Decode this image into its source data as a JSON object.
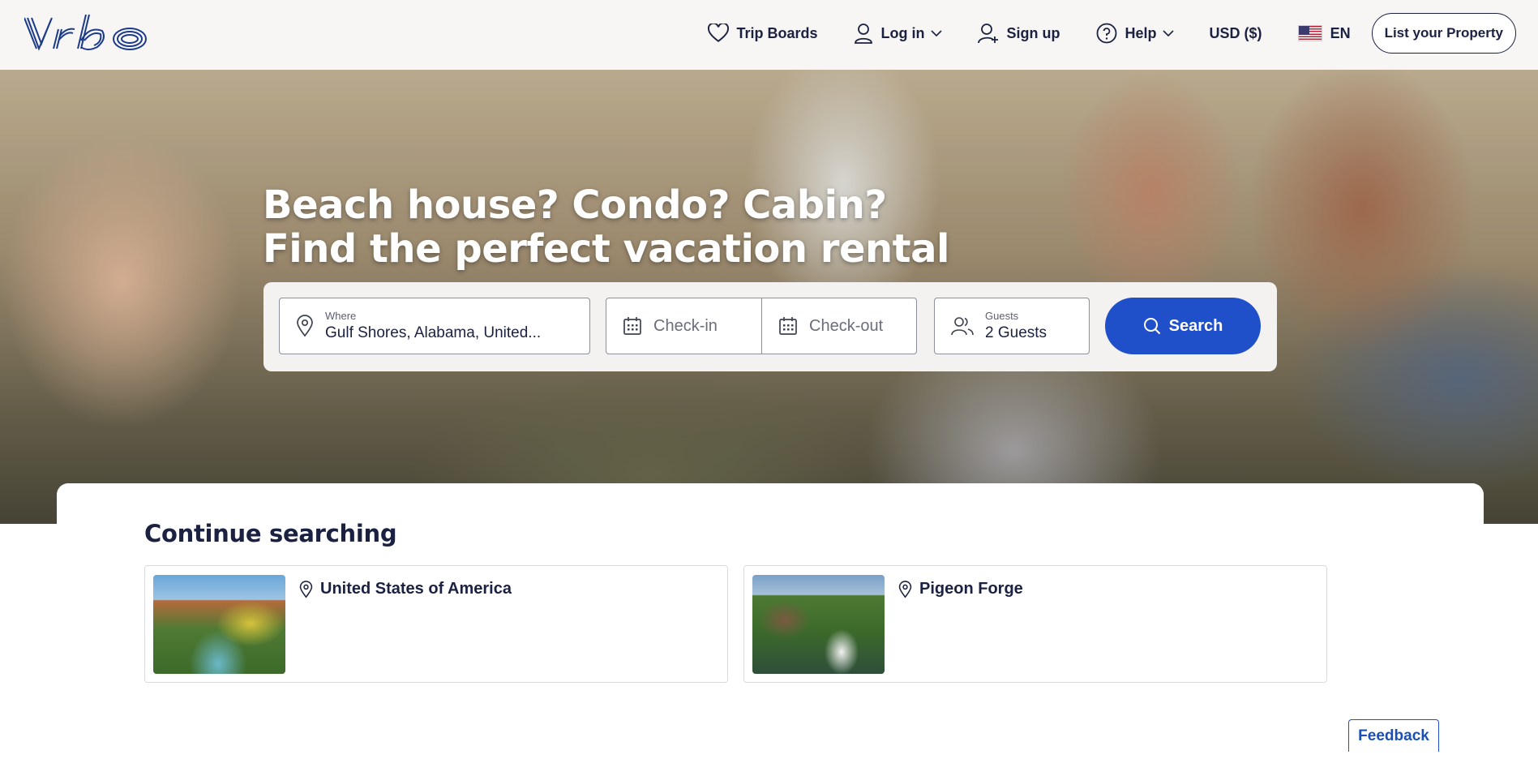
{
  "brand": {
    "logo_text": "Vrbo",
    "accent": "#2050c9",
    "text_dark": "#1b2140"
  },
  "header": {
    "nav": [
      {
        "label": "Trip Boards",
        "icon": "heart-icon"
      },
      {
        "label": "Log in",
        "icon": "user-icon",
        "dropdown": true
      },
      {
        "label": "Sign up",
        "icon": "user-plus-icon"
      },
      {
        "label": "Help",
        "icon": "help-circle-icon",
        "dropdown": true
      },
      {
        "label": "USD ($)"
      },
      {
        "label": "EN",
        "icon": "us-flag-icon"
      }
    ],
    "list_property": "List your Property"
  },
  "hero": {
    "headline_line1": "Beach house? Condo? Cabin?",
    "headline_line2": "Find the perfect vacation rental"
  },
  "search": {
    "where_label": "Where",
    "where_value": "Gulf Shores, Alabama, United...",
    "checkin_placeholder": "Check-in",
    "checkout_placeholder": "Check-out",
    "guests_label": "Guests",
    "guests_value": "2 Guests",
    "button_label": "Search"
  },
  "continue_searching": {
    "title": "Continue searching",
    "items": [
      {
        "location": "United States of America",
        "image": "canyon-river-photo"
      },
      {
        "location": "Pigeon Forge",
        "image": "mill-waterfall-photo"
      }
    ]
  },
  "feedback_label": "Feedback"
}
